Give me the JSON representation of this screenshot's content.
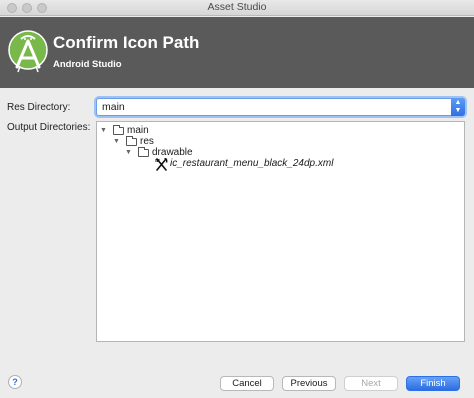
{
  "window": {
    "title": "Asset Studio"
  },
  "header": {
    "title": "Confirm Icon Path",
    "subtitle": "Android Studio",
    "logo_icon": "android-studio-logo-icon",
    "background": "#5a5a5a"
  },
  "form": {
    "res_directory_label": "Res Directory:",
    "res_directory_value": "main",
    "output_directories_label": "Output Directories:"
  },
  "tree": {
    "items": [
      {
        "label": "main",
        "icon": "folder-icon",
        "expanded": true
      },
      {
        "label": "res",
        "icon": "folder-icon",
        "expanded": true
      },
      {
        "label": "drawable",
        "icon": "folder-icon",
        "expanded": true
      },
      {
        "label": "ic_restaurant_menu_black_24dp.xml",
        "icon": "restaurant-menu-icon"
      }
    ]
  },
  "footer": {
    "help_label": "?",
    "cancel_label": "Cancel",
    "previous_label": "Previous",
    "next_label": "Next",
    "finish_label": "Finish",
    "accent": "#2c6de3"
  }
}
